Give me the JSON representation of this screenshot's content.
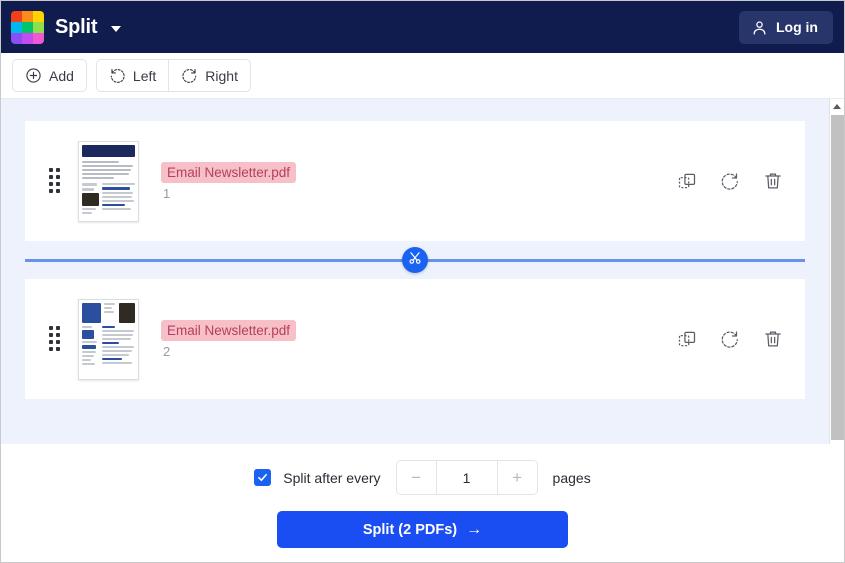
{
  "header": {
    "brand_name": "Split",
    "logo_colors": [
      "#f43f1c",
      "#fb8c1a",
      "#ffd400",
      "#00b8f0",
      "#00c46a",
      "#8ee04a",
      "#8b4ef5",
      "#c44bf0",
      "#f05ad0"
    ],
    "dropdown_icon": "chevron-down-icon",
    "login_label": "Log in",
    "login_icon": "user-icon",
    "bg_color": "#101c4e",
    "login_bg_color": "#27356b"
  },
  "toolbar": {
    "add_label": "Add",
    "add_icon": "plus-circle-icon",
    "rotate_left_label": "Left",
    "rotate_left_icon": "rotate-left-icon",
    "rotate_right_label": "Right",
    "rotate_right_icon": "rotate-right-icon"
  },
  "pages": [
    {
      "filename": "Email Newsletter.pdf",
      "page_number": "1",
      "drag_handle_icon": "drag-handle-icon",
      "duplicate_icon": "duplicate-icon",
      "rotate_icon": "rotate-right-icon",
      "delete_icon": "trash-icon"
    },
    {
      "filename": "Email Newsletter.pdf",
      "page_number": "2",
      "drag_handle_icon": "drag-handle-icon",
      "duplicate_icon": "duplicate-icon",
      "rotate_icon": "rotate-right-icon",
      "delete_icon": "trash-icon"
    }
  ],
  "splitter": {
    "icon": "scissors-icon",
    "line_color": "#6b92ea",
    "button_color": "#1a63f2"
  },
  "footer": {
    "checkbox_checked": true,
    "checkbox_color": "#1a63f2",
    "split_after_label": "Split after every",
    "decrement_label": "−",
    "stepper_value": "1",
    "increment_label": "+",
    "pages_label": "pages",
    "cta_label": "Split (2 PDFs)",
    "cta_arrow": "→",
    "cta_color": "#1a4df2"
  },
  "filename_highlight": {
    "bg_color": "#f7bfc7",
    "text_color": "#b4405c"
  },
  "scrollbar": {
    "up_arrow_icon": "scroll-up-arrow-icon",
    "thumb_color": "#c1c1c1"
  }
}
